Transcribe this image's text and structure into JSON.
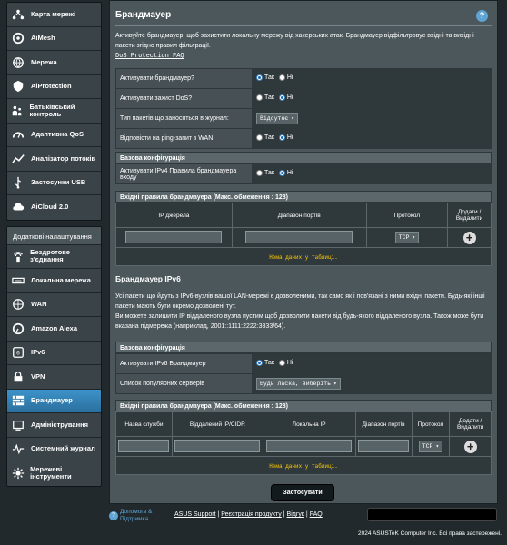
{
  "sidebar": {
    "top_items": [
      {
        "label": "Карта мережі",
        "icon": "network-map-icon"
      },
      {
        "label": "AiMesh",
        "icon": "aimesh-icon"
      },
      {
        "label": "Мережа",
        "icon": "globe-icon"
      },
      {
        "label": "AiProtection",
        "icon": "shield-icon"
      },
      {
        "label": "Батьківський контроль",
        "icon": "parental-control-icon"
      },
      {
        "label": "Адаптивна QoS",
        "icon": "qos-icon"
      },
      {
        "label": "Аналізатор потоків",
        "icon": "traffic-analyzer-icon"
      },
      {
        "label": "Застосунки USB",
        "icon": "usb-icon"
      },
      {
        "label": "AiCloud 2.0",
        "icon": "cloud-icon"
      }
    ],
    "advanced_header": "Додаткові налаштування",
    "advanced_items": [
      {
        "label": "Бездротове з'єднання",
        "icon": "wireless-icon"
      },
      {
        "label": "Локальна мережа",
        "icon": "lan-icon"
      },
      {
        "label": "WAN",
        "icon": "wan-globe-icon"
      },
      {
        "label": "Amazon Alexa",
        "icon": "alexa-icon"
      },
      {
        "label": "IPv6",
        "icon": "ipv6-icon"
      },
      {
        "label": "VPN",
        "icon": "vpn-icon"
      },
      {
        "label": "Брандмауер",
        "icon": "firewall-icon"
      },
      {
        "label": "Адміністрування",
        "icon": "admin-icon"
      },
      {
        "label": "Системний журнал",
        "icon": "syslog-icon"
      },
      {
        "label": "Мережеві інструменти",
        "icon": "network-tools-icon"
      }
    ]
  },
  "page": {
    "title": "Брандмауер",
    "description": "Активуйте брандмауер, щоб захистити локальну мережу від хакерських атак. Брандмауер відфільтровує вхідні та вихідні пакети згідно правил фільтрації.",
    "faq_link": "DoS Protection FAQ"
  },
  "settings": [
    {
      "label": "Активувати брандмауер?",
      "type": "radio",
      "yes": "Так",
      "no": "Ні",
      "selected": "yes"
    },
    {
      "label": "Активувати захист DoS?",
      "type": "radio",
      "yes": "Так",
      "no": "Ні",
      "selected": "no"
    },
    {
      "label": "Тип пакетів що заносяться в журнал:",
      "type": "select",
      "value": "Відсутнє"
    },
    {
      "label": "Відповісти на ping-запит з WAN",
      "type": "radio",
      "yes": "Так",
      "no": "Ні",
      "selected": "no"
    }
  ],
  "basic_config": {
    "header": "Базова конфігурація",
    "ipv4_rules_label": "Активувати IPv4 Правила брандмауера входу",
    "yes": "Так",
    "no": "Ні",
    "selected": "no"
  },
  "inbound_v4": {
    "header": "Вхідні правила брандмауера (Макс. обмеження : 128)",
    "columns": [
      "IP джерела",
      "Діапазон портів",
      "Протокол",
      "Додати / Видалити"
    ],
    "protocol": "TCP",
    "empty": "Нема даних у таблиці."
  },
  "ipv6": {
    "title": "Брандмауер IPv6",
    "line1": "Усі пакети що йдуть з IPv6-вузлів вашої LAN-мережі є дозволеними, так само як і пов'язані з ними вхідні пакети. Будь-які інші пакети мають бути окремо дозволені тут.",
    "line2": "Ви можете залишити IP віддаленого вузла пустим щоб дозволити пакети від будь-якого віддаленого вузла. Також може бути вказана підмережа (наприклад, 2001::1111:2222:3333/64).",
    "config_header": "Базова конфігурація",
    "enable_label": "Активувати IPv6 Брандмауер",
    "yes": "Так",
    "no": "Ні",
    "selected": "yes",
    "servers_label": "Список популярних серверів",
    "servers_value": "Будь ласка, виберіть"
  },
  "inbound_v6": {
    "header": "Вхідні правила брандмауера (Макс. обмеження : 128)",
    "columns": [
      "Назва служби",
      "Віддалений IP/CIDR",
      "Локальна IP",
      "Діапазон портів",
      "Протокол",
      "Додати / Видалити"
    ],
    "protocol": "TCP",
    "empty": "Нема даних у таблиці."
  },
  "apply_label": "Застосувати",
  "footer": {
    "help": "Допомога & Підтримка",
    "links": [
      "ASUS Support",
      "Реєстрація продукту",
      "Відгук",
      "FAQ"
    ],
    "copyright": "2024 ASUSTeK Computer Inc. Всі права застережені."
  }
}
